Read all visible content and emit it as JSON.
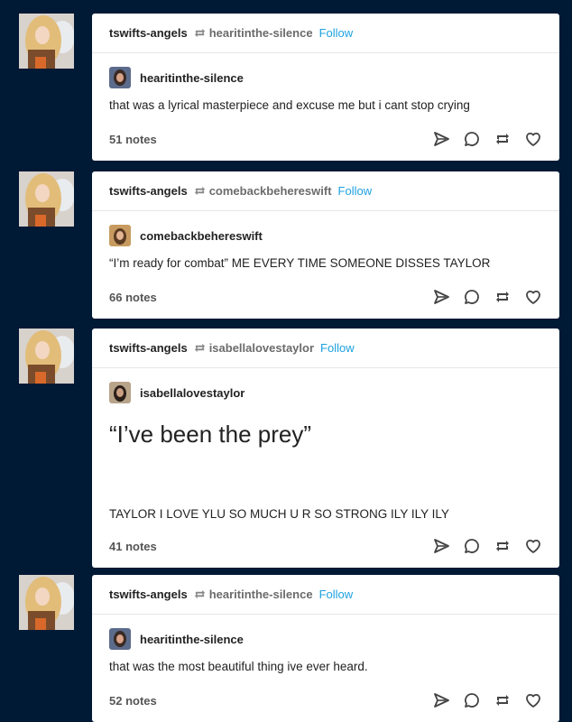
{
  "posts": [
    {
      "poster": "tswifts-angels",
      "source": "hearitinthe-silence",
      "follow_label": "Follow",
      "trail_user": "hearitinthe-silence",
      "body": "that was a lyrical masterpiece and excuse me but i cant stop crying",
      "notes": "51 notes"
    },
    {
      "poster": "tswifts-angels",
      "source": "comebackbehereswift",
      "follow_label": "Follow",
      "trail_user": "comebackbehereswift",
      "body": "“I’m ready for combat” ME EVERY TIME SOMEONE DISSES TAYLOR",
      "notes": "66 notes"
    },
    {
      "poster": "tswifts-angels",
      "source": "isabellalovestaylor",
      "follow_label": "Follow",
      "trail_user": "isabellalovestaylor",
      "quote": "“I’ve been the prey”",
      "body": "TAYLOR I LOVE YLU SO MUCH U R SO STRONG ILY ILY ILY",
      "notes": "41 notes"
    },
    {
      "poster": "tswifts-angels",
      "source": "hearitinthe-silence",
      "follow_label": "Follow",
      "trail_user": "hearitinthe-silence",
      "body": "that was the most beautiful thing ive ever heard.",
      "notes": "52 notes"
    }
  ],
  "icons": {
    "avatar": "blonde-avatar-icon",
    "reblog": "reblog-icon",
    "share": "share-icon",
    "reply": "reply-icon",
    "like": "heart-icon"
  },
  "colors": {
    "background": "#001935",
    "follow": "#1da1e0"
  }
}
